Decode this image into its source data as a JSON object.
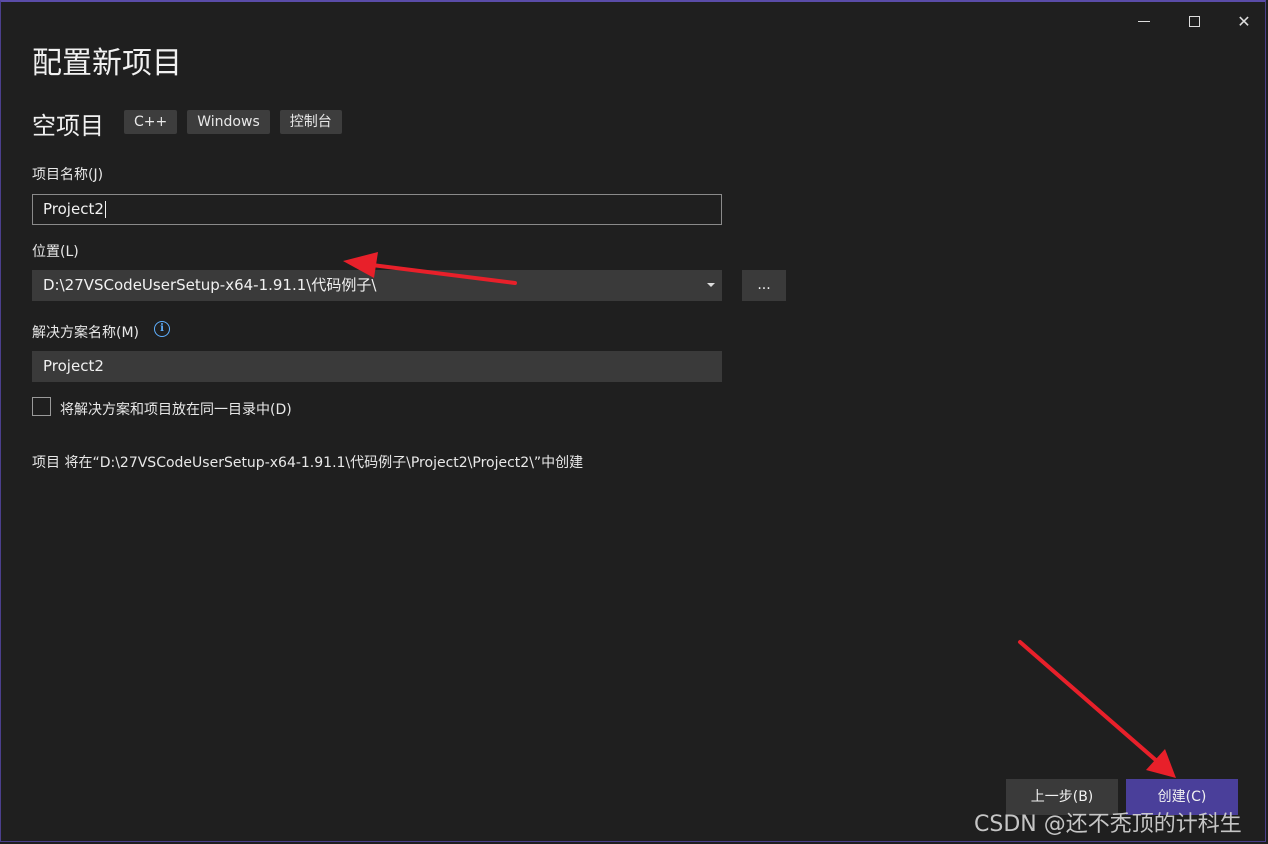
{
  "window": {
    "minimize_icon": "minimize-icon",
    "maximize_icon": "maximize-icon",
    "close_glyph": "✕"
  },
  "header": {
    "title": "配置新项目"
  },
  "template": {
    "name": "空项目",
    "tags": [
      "C++",
      "Windows",
      "控制台"
    ]
  },
  "form": {
    "project_name_label": "项目名称(J)",
    "project_name_value": "Project2",
    "location_label": "位置(L)",
    "location_value": "D:\\27VSCodeUserSetup-x64-1.91.1\\代码例子\\",
    "browse_label": "...",
    "solution_name_label": "解决方案名称(M)",
    "solution_name_value": "Project2",
    "same_dir_checkbox_label": "将解决方案和项目放在同一目录中(D)",
    "same_dir_checked": false,
    "summary": "项目 将在“D:\\27VSCodeUserSetup-x64-1.91.1\\代码例子\\Project2\\Project2\\”中创建"
  },
  "footer": {
    "back_label": "上一步(B)",
    "create_label": "创建(C)"
  },
  "watermark": "CSDN @还不秃顶的计科生",
  "colors": {
    "background": "#1f1f1f",
    "accent": "#4a3f9a",
    "annotation_arrow": "#e8202a",
    "info": "#5fb0ff"
  }
}
